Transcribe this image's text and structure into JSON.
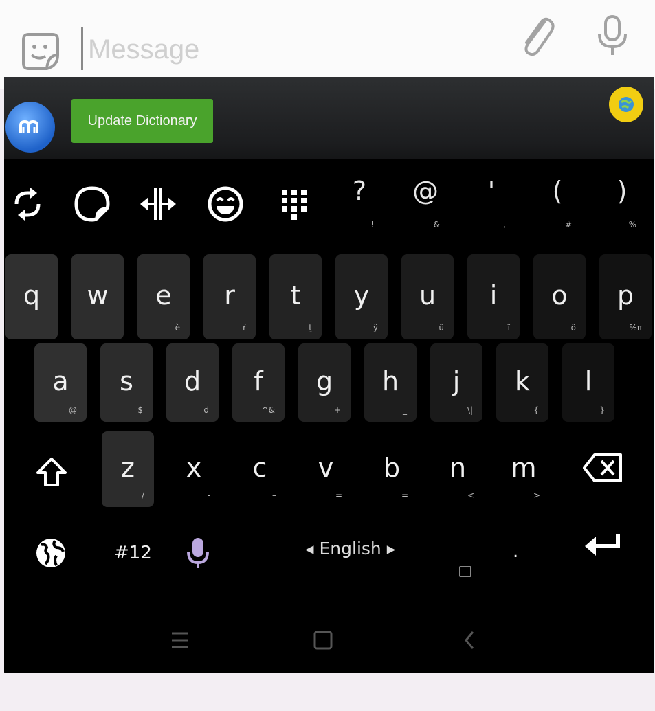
{
  "message_bar": {
    "placeholder": "Message",
    "icons": [
      "sticker-icon",
      "paperclip-icon",
      "microphone-icon"
    ]
  },
  "keyboard_top": {
    "update_button": "Update Dictionary",
    "icons": [
      "keyboard-logo-icon",
      "theme-icon"
    ]
  },
  "toolbar": {
    "icons": [
      "sync-icon",
      "sticker-icon",
      "cursor-move-icon",
      "emoji-icon",
      "numpad-icon"
    ],
    "symbols": [
      {
        "main": "?",
        "sub": "!"
      },
      {
        "main": "@",
        "sub": "&"
      },
      {
        "main": "'",
        "sub": ","
      },
      {
        "main": "(",
        "sub": "#"
      },
      {
        "main": ")",
        "sub": "%"
      }
    ]
  },
  "rows": {
    "row1": [
      {
        "main": "q",
        "sub": ""
      },
      {
        "main": "w",
        "sub": ""
      },
      {
        "main": "e",
        "sub": "è"
      },
      {
        "main": "r",
        "sub": "ŕ"
      },
      {
        "main": "t",
        "sub": "ţ"
      },
      {
        "main": "y",
        "sub": "ÿ"
      },
      {
        "main": "u",
        "sub": "ü"
      },
      {
        "main": "i",
        "sub": "ï"
      },
      {
        "main": "o",
        "sub": "ö"
      },
      {
        "main": "p",
        "sub": "%π"
      }
    ],
    "row2": [
      {
        "main": "a",
        "sub": "@"
      },
      {
        "main": "s",
        "sub": "$"
      },
      {
        "main": "d",
        "sub": "đ"
      },
      {
        "main": "f",
        "sub": "^&"
      },
      {
        "main": "g",
        "sub": "+"
      },
      {
        "main": "h",
        "sub": "_"
      },
      {
        "main": "j",
        "sub": "\\|"
      },
      {
        "main": "k",
        "sub": "{"
      },
      {
        "main": "l",
        "sub": "}"
      }
    ],
    "row3": [
      {
        "main": "z",
        "sub": "/"
      },
      {
        "main": "x",
        "sub": "-"
      },
      {
        "main": "c",
        "sub": "–"
      },
      {
        "main": "v",
        "sub": "="
      },
      {
        "main": "b",
        "sub": "="
      },
      {
        "main": "n",
        "sub": "<"
      },
      {
        "main": "m",
        "sub": ">"
      }
    ]
  },
  "bottom_row": {
    "numbers_label": "#12",
    "space_label": "◂ English ▸",
    "period": ".",
    "icons": [
      "globe-icon",
      "microphone-icon",
      "enter-icon",
      "shift-icon",
      "backspace-icon"
    ]
  },
  "navbar": {
    "icons": [
      "menu-icon",
      "home-icon",
      "back-icon"
    ]
  },
  "colors": {
    "keyboard_bg": "#000000",
    "key_bg_top": "#2b2b2b",
    "update_button": "#4aa32c",
    "theme_button": "#f1cd12"
  }
}
